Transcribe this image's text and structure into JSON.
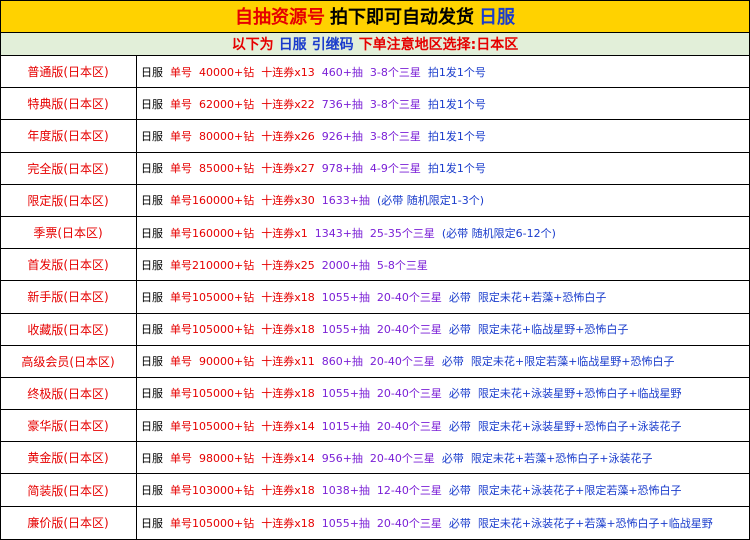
{
  "header": {
    "title_part1": "自抽资源号",
    "title_part2": "拍下即可自动发货",
    "title_part3": "日服",
    "sub_part1": "以下为",
    "sub_part2": "日服",
    "sub_part3": "引继码",
    "sub_part4": "下单注意地区选择:日本区"
  },
  "colors": {
    "title_bg": "#ffd200",
    "sub_bg": "#e2efd9",
    "red": "#e60000",
    "purple": "#7a1fd6",
    "blue": "#1a3ccc"
  },
  "rows": [
    {
      "name": "普通版(日本区)",
      "server": "日服",
      "main": "单号  40000+钻  十连券x13",
      "draws": "460+抽  3-8个三星",
      "extra": "拍1发1个号"
    },
    {
      "name": "特典版(日本区)",
      "server": "日服",
      "main": "单号  62000+钻  十连券x22",
      "draws": "736+抽  3-8个三星",
      "extra": "拍1发1个号"
    },
    {
      "name": "年度版(日本区)",
      "server": "日服",
      "main": "单号  80000+钻  十连券x26",
      "draws": "926+抽  3-8个三星",
      "extra": "拍1发1个号"
    },
    {
      "name": "完全版(日本区)",
      "server": "日服",
      "main": "单号  85000+钻  十连券x27",
      "draws": "978+抽  4-9个三星",
      "extra": "拍1发1个号"
    },
    {
      "name": "限定版(日本区)",
      "server": "日服",
      "main": "单号160000+钻  十连券x30",
      "draws": "1633+抽",
      "extra": "(必带 随机限定1-3个)"
    },
    {
      "name": "季票(日本区)",
      "server": "日服",
      "main": "单号160000+钻  十连券x1",
      "draws": "1343+抽  25-35个三星",
      "extra": "(必带 随机限定6-12个)"
    },
    {
      "name": "首发版(日本区)",
      "server": "日服",
      "main": "单号210000+钻  十连券x25",
      "draws": "2000+抽  5-8个三星",
      "extra": ""
    },
    {
      "name": "新手版(日本区)",
      "server": "日服",
      "main": "单号105000+钻  十连券x18",
      "draws": "1055+抽  20-40个三星",
      "extra": "必带  限定未花+若藻+恐怖白子"
    },
    {
      "name": "收藏版(日本区)",
      "server": "日服",
      "main": "单号105000+钻  十连券x18",
      "draws": "1055+抽  20-40个三星",
      "extra": "必带  限定未花+临战星野+恐怖白子"
    },
    {
      "name": "高级会员(日本区)",
      "server": "日服",
      "main": "单号  90000+钻  十连券x11",
      "draws": "860+抽  20-40个三星",
      "extra": "必带  限定未花+限定若藻+临战星野+恐怖白子"
    },
    {
      "name": "终极版(日本区)",
      "server": "日服",
      "main": "单号105000+钻  十连券x18",
      "draws": "1055+抽  20-40个三星",
      "extra": "必带  限定未花+泳装星野+恐怖白子+临战星野"
    },
    {
      "name": "豪华版(日本区)",
      "server": "日服",
      "main": "单号105000+钻  十连券x14",
      "draws": "1015+抽  20-40个三星",
      "extra": "必带  限定未花+泳装星野+恐怖白子+泳装花子"
    },
    {
      "name": "黄金版(日本区)",
      "server": "日服",
      "main": "单号  98000+钻  十连券x14",
      "draws": "956+抽  20-40个三星",
      "extra": "必带  限定未花+若藻+恐怖白子+泳装花子"
    },
    {
      "name": "简装版(日本区)",
      "server": "日服",
      "main": "单号103000+钻  十连券x18",
      "draws": "1038+抽  12-40个三星",
      "extra": "必带  限定未花+泳装花子+限定若藻+恐怖白子"
    },
    {
      "name": "廉价版(日本区)",
      "server": "日服",
      "main": "单号105000+钻  十连券x18",
      "draws": "1055+抽  20-40个三星",
      "extra": "必带  限定未花+泳装花子+若藻+恐怖白子+临战星野"
    }
  ]
}
